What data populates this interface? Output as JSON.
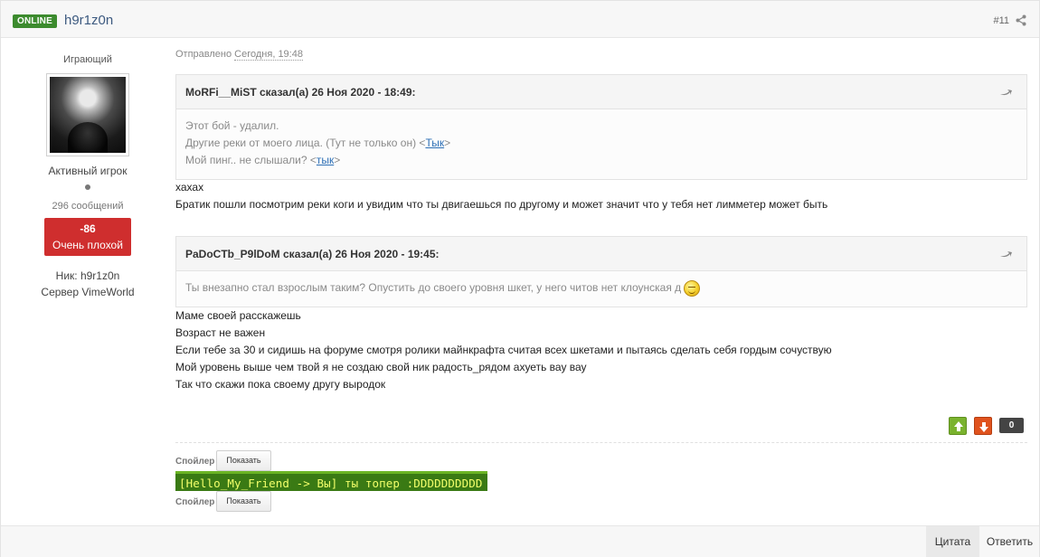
{
  "header": {
    "online_badge": "ONLINE",
    "username": "h9r1z0n",
    "post_number": "#11"
  },
  "author": {
    "title": "Играющий",
    "rank": "Активный игрок",
    "messages": "296 сообщений",
    "reputation_value": "-86",
    "reputation_label": "Очень плохой",
    "nick": "Ник: h9r1z0n",
    "server": "Сервер VimeWorld"
  },
  "post": {
    "sent_prefix": "Отправлено ",
    "sent_date": "Сегодня, 19:48",
    "quote1": {
      "author": "MoRFi__MiST сказал(а) 26 Ноя 2020 - 18:49:",
      "line1": "Этот бой - удалил.",
      "line2_prefix": "Другие реки от моего лица. (Тут не только он) <",
      "line2_link": "Тык",
      "line2_suffix": ">",
      "line3_prefix": "Мой пинг.. не слышали? <",
      "line3_link": "тык",
      "line3_suffix": ">"
    },
    "reply1": [
      "хахах",
      "Братик пошли посмотрим реки коги и увидим что ты двигаешься по другому и может значит что у тебя нет лимметер может быть"
    ],
    "quote2": {
      "author": "PaDoCTb_P9lDoM сказал(а) 26 Ноя 2020 - 19:45:",
      "line1": "Ты внезапно стал взрослым таким? Опустить до своего уровня шкет, у него читов нет клоунская д"
    },
    "reply2": [
      "Маме своей расскажешь",
      "Возраст не важен",
      "Если тебе за 30 и сидишь на форуме смотря ролики майнкрафта считая всех шкетами и пытаясь сделать себя гордым сочуствую",
      "Мой уровень выше чем твой я не создаю свой ник радость_рядом ахуеть вау вау",
      "Так что скажи пока своему другу выродок"
    ],
    "vote_count": "0"
  },
  "signature": {
    "spoiler_label": "Спойлер",
    "show_label": "Показать",
    "chat_text": "[Hello_My_Friend -> Вы] ты топер :DDDDDDDDDD"
  },
  "footer": {
    "quote_button": "Цитата",
    "reply_button": "Ответить"
  },
  "colors": {
    "online": "#3c8b2e",
    "reputation_bad": "#cf2e2e",
    "vote_up": "#7ab32e",
    "vote_down": "#e0531e",
    "chat_bg": "#3a7a14",
    "chat_text": "#f2ff6a",
    "link": "#2d6fb5"
  },
  "icons": {
    "share": "share-icon",
    "quote_jump": "reply-arrow-icon",
    "vote_up": "arrow-up-icon",
    "vote_down": "arrow-down-icon",
    "smiley": "smiley-icon"
  }
}
